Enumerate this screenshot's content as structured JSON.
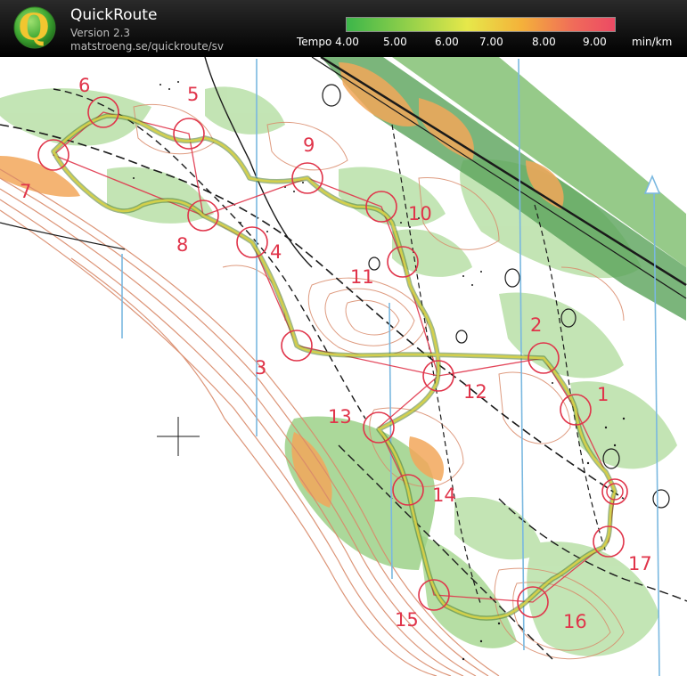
{
  "app": {
    "title": "QuickRoute",
    "version": "Version 2.3",
    "url": "matstroeng.se/quickroute/sv",
    "logo_letter": "Q",
    "logo_icon": "quickroute-logo-icon"
  },
  "legend": {
    "labels": [
      "Tempo 4.00",
      "5.00",
      "6.00",
      "7.00",
      "8.00",
      "9.00"
    ],
    "unit": "min/km",
    "pace_min": 4.0,
    "pace_max": 9.5,
    "colors": [
      "#3cb64a",
      "#8fcf4a",
      "#e6e84a",
      "#f4b23a",
      "#f06a5a",
      "#ec4a64"
    ]
  },
  "map": {
    "colors": {
      "control": "#e0344a",
      "magnetic_north": "#7ab8e0",
      "vegetation": "#a8d89a",
      "open_land": "#f0a050",
      "contour": "#d98a6a",
      "track": "#5a9a3a",
      "track_highlight": "#d8d84a"
    },
    "controls": [
      {
        "number": "1"
      },
      {
        "number": "2"
      },
      {
        "number": "3"
      },
      {
        "number": "4"
      },
      {
        "number": "5"
      },
      {
        "number": "6"
      },
      {
        "number": "7"
      },
      {
        "number": "8"
      },
      {
        "number": "9"
      },
      {
        "number": "10"
      },
      {
        "number": "11"
      },
      {
        "number": "12"
      },
      {
        "number": "13"
      },
      {
        "number": "14"
      },
      {
        "number": "15"
      },
      {
        "number": "16"
      },
      {
        "number": "17"
      }
    ]
  }
}
